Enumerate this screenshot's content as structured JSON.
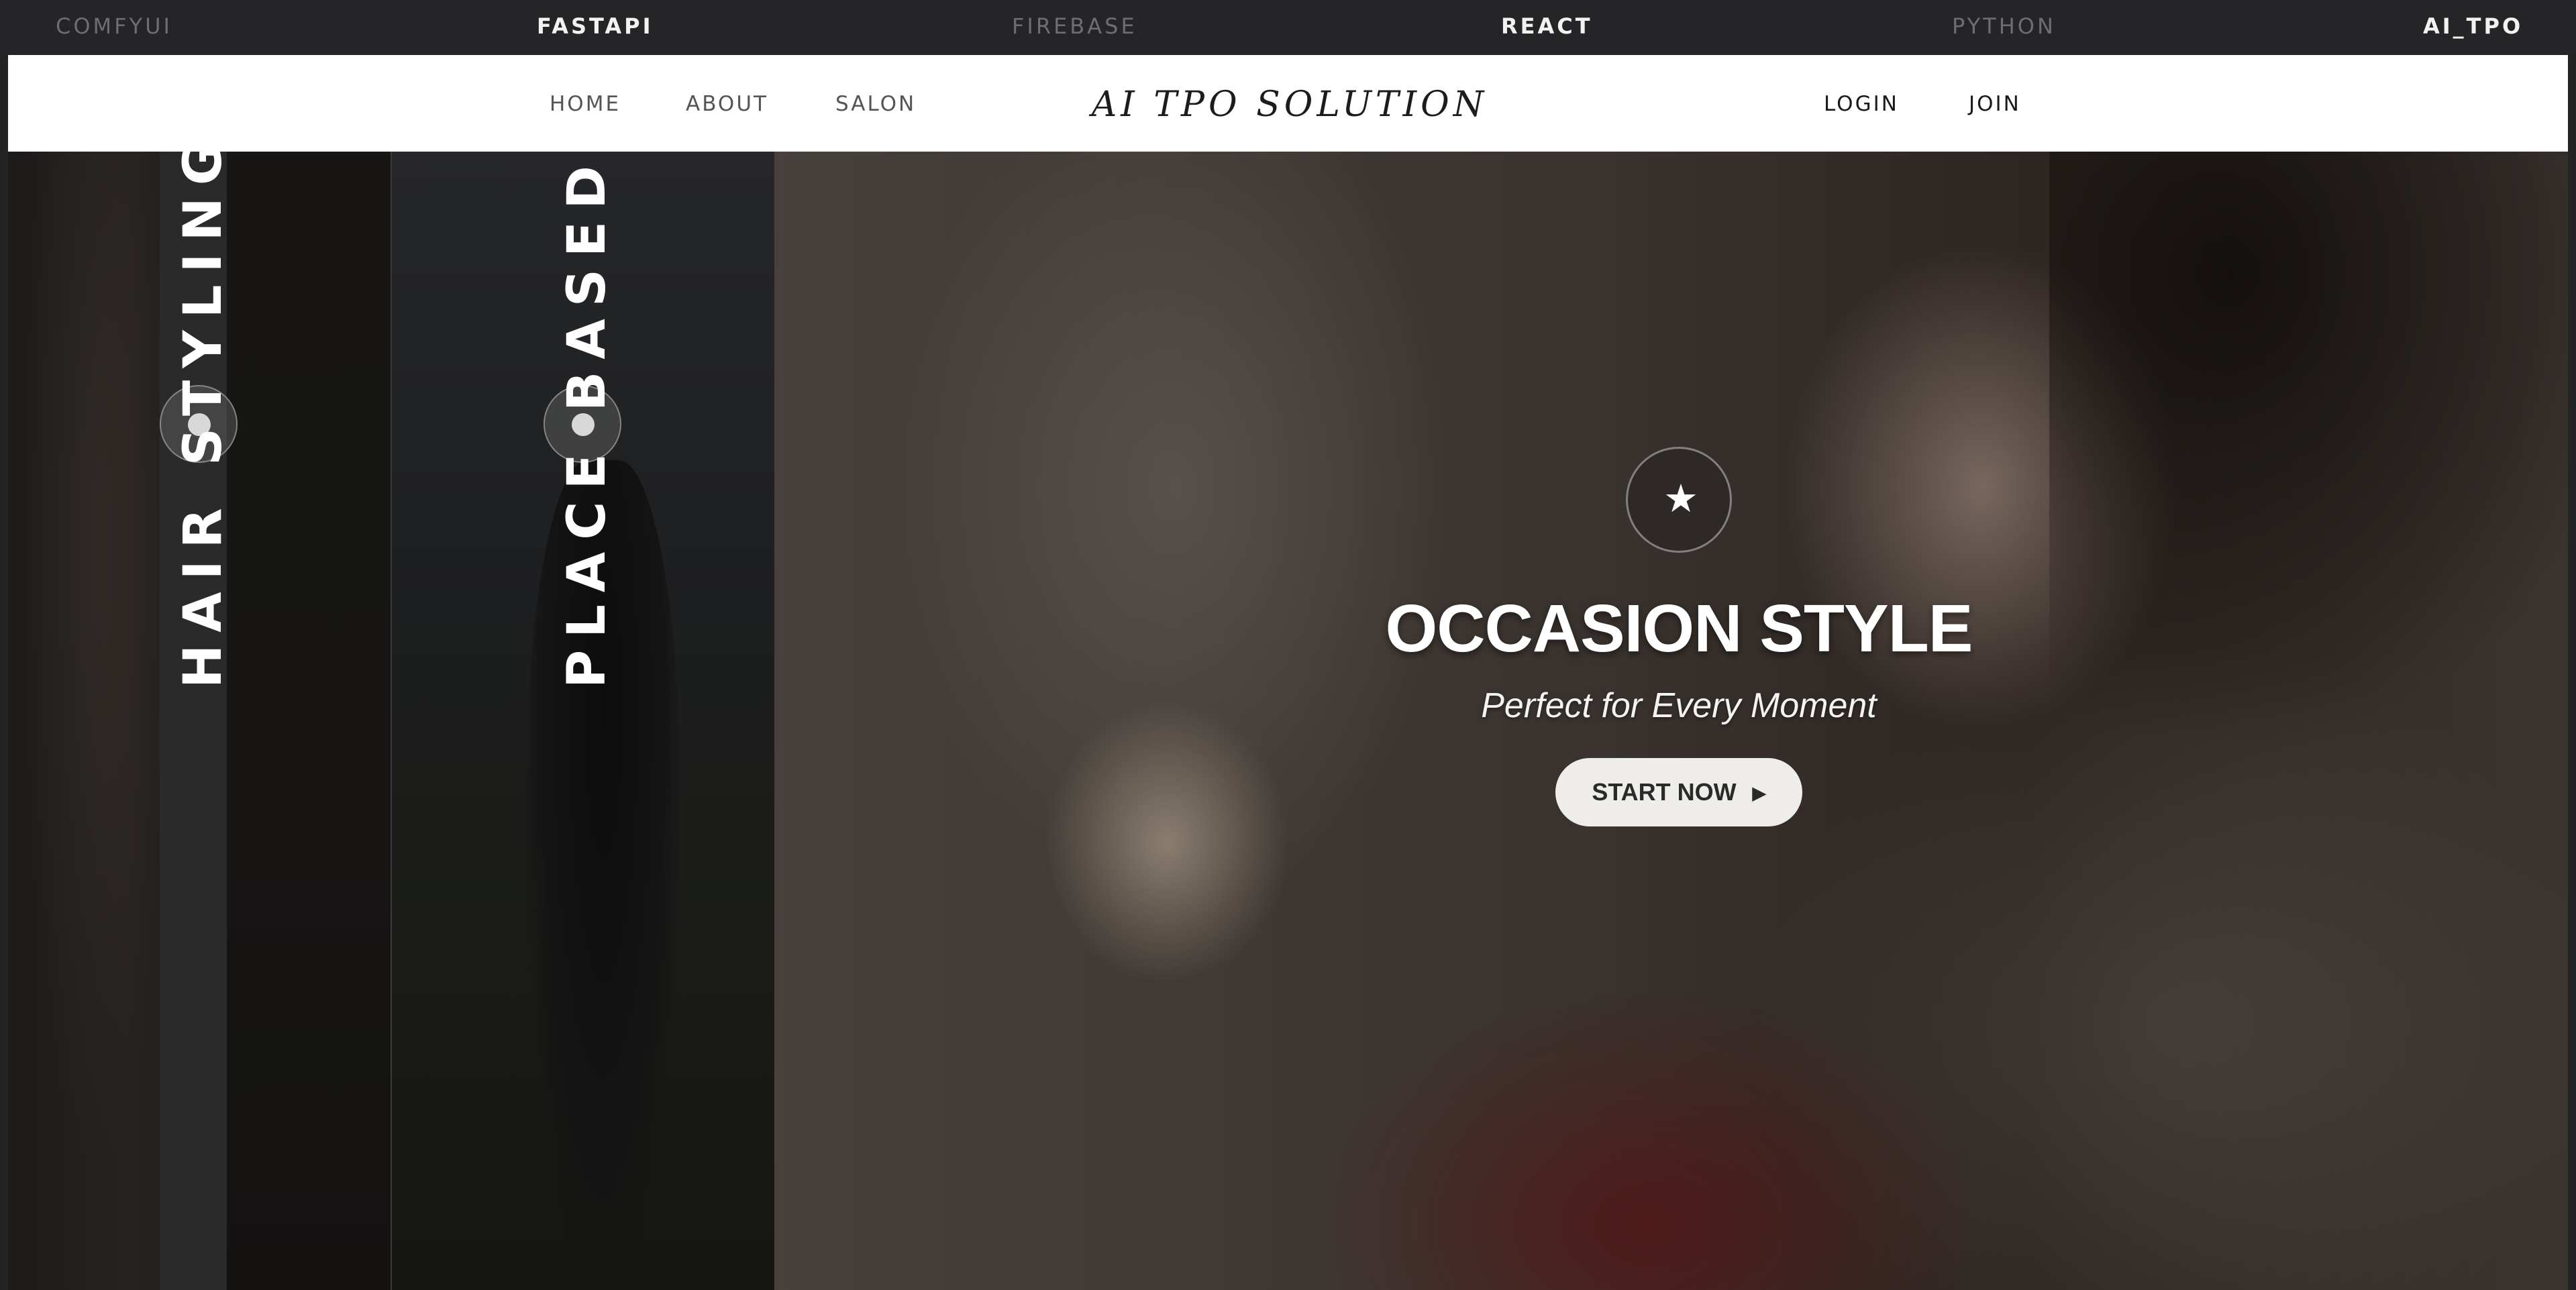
{
  "top_strip": {
    "items": [
      "COMFYUI",
      "FASTAPI",
      "FIREBASE",
      "REACT",
      "PYTHON",
      "AI_TPO"
    ]
  },
  "navbar": {
    "left_links": [
      "HOME",
      "ABOUT",
      "SALON"
    ],
    "brand": "AI TPO SOLUTION",
    "right_links": [
      "LOGIN",
      "JOIN"
    ]
  },
  "panels": {
    "hair_styling_label": "HAIR STYLING",
    "place_based_label": "PLACE BASED"
  },
  "hero": {
    "icon": "star-icon",
    "title": "OCCASION STYLE",
    "subtitle": "Perfect for Every Moment",
    "button_label": "START NOW",
    "button_icon": "play-arrow-icon"
  },
  "colors": {
    "background": "#242426",
    "navbar": "#ffffff",
    "button": "#efedea"
  }
}
